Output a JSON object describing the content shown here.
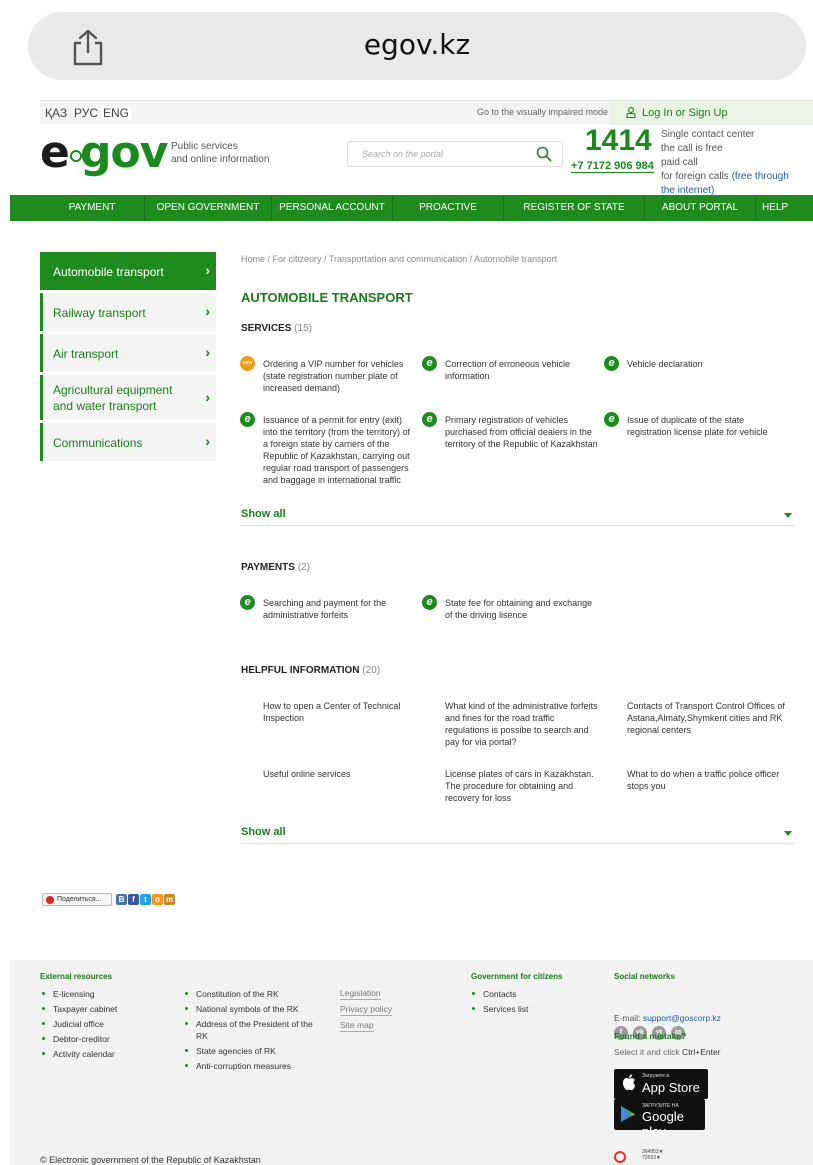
{
  "browser": {
    "url": "egov.kz"
  },
  "topline": {
    "languages": [
      "ҚАЗ",
      "РУС",
      "ENG"
    ],
    "impaired": "Go to the visually impaired mode",
    "login": "Log In or Sign Up"
  },
  "header": {
    "logo_e": "e",
    "logo_gov": "gov",
    "tagline_1": "Public services",
    "tagline_2": "and online information",
    "search_placeholder": "Search on the portal",
    "hotline": "1414",
    "phone": "+7 7172 906 984",
    "contact_1": "Single contact center",
    "contact_2": "the call is free",
    "contact_3": "paid call",
    "contact_4": "for foreign calls",
    "contact_link_1": "(free through",
    "contact_link_2": "the internet)"
  },
  "nav": [
    "PAYMENT",
    "OPEN GOVERNMENT",
    "PERSONAL ACCOUNT",
    "PROACTIVE SERVICES",
    "REGISTER OF STATE SERVICES",
    "ABOUT PORTAL",
    "HELP"
  ],
  "sidebar": [
    {
      "line1": "Automobile transport",
      "line2": ""
    },
    {
      "line1": "Railway transport",
      "line2": ""
    },
    {
      "line1": "Air transport",
      "line2": ""
    },
    {
      "line1": "Agricultural equipment",
      "line2": "and water transport"
    },
    {
      "line1": "Communications",
      "line2": ""
    }
  ],
  "main": {
    "breadcrumb": "Home / For citizenry / Transportation and communication / Automobile transport",
    "title": "AUTOMOBILE TRANSPORT",
    "services_label": "SERVICES",
    "services_count": "(15)",
    "services": [
      {
        "badge": "new",
        "lines": [
          "Ordering a VIP number for vehicles",
          "(state registration number plate of",
          "increased demand)"
        ]
      },
      {
        "badge": "e",
        "lines": [
          "Correction of erroneous vehicle",
          "information"
        ]
      },
      {
        "badge": "e",
        "lines": [
          "Vehicle declaration"
        ]
      },
      {
        "badge": "e",
        "lines": [
          "Issuance of a permit for entry (exit)",
          "into the territory (from the territory) of",
          "a foreign state by carriers of the",
          "Republic of Kazakhstan, carrying out",
          "regular road transport of passengers",
          "and baggage in international traffic"
        ]
      },
      {
        "badge": "e",
        "lines": [
          "Primary registration of vehicles",
          "purchased from official dealers in the",
          "territory of the Republic of Kazakhstan"
        ]
      },
      {
        "badge": "e",
        "lines": [
          "Issue of duplicate of the state",
          "registration license plate for vehicle"
        ]
      }
    ],
    "show_all": "Show all",
    "payments_label": "PAYMENTS",
    "payments_count": "(2)",
    "payments": [
      {
        "badge": "e",
        "lines": [
          "Searching and payment for the",
          "administrative forfeits"
        ]
      },
      {
        "badge": "e",
        "lines": [
          "State fee for obtaining and exchange",
          "of the driving lisence"
        ]
      }
    ],
    "helpful_label": "HELPFUL INFORMATION",
    "helpful_count": "(20)",
    "helpful": [
      {
        "lines": [
          "How to open a Center of Technical",
          "Inspection"
        ]
      },
      {
        "lines": [
          "What kind of the administrative forfeits",
          "and fines for the road traffic",
          "regulations is possibe to search and",
          "pay for via portal?"
        ]
      },
      {
        "lines": [
          "Contacts of Transport Control Offices of",
          "Astana,Almaty,Shymkent cities and RK",
          "regional centers"
        ]
      },
      {
        "lines": [
          "Useful online services"
        ]
      },
      {
        "lines": [
          "License plates of cars in Kazakhstan.",
          "The procedure for obtaining and",
          "recovery for loss"
        ]
      },
      {
        "lines": [
          "What to do when a traffic police officer",
          "stops you"
        ]
      }
    ]
  },
  "share": {
    "label": "Поделиться...",
    "icons": [
      "В",
      "f",
      "t",
      "o",
      "m"
    ]
  },
  "footer": {
    "external_title": "External resources",
    "external": [
      "E-licensing",
      "Taxpayer cabinet",
      "Judicial office",
      "Debtor-creditor",
      "Activity calendar"
    ],
    "col2": [
      "Constitution of the RK",
      "National symbols of the RK",
      "Address of the President of the",
      "RK",
      "State agencies of RK",
      "Anti-corruption measures"
    ],
    "links": [
      "Legislation",
      "Privacy policy",
      "Site map"
    ],
    "gov_title": "Government for citizens",
    "gov": [
      "Contacts",
      "Services list"
    ],
    "social_title": "Social networks",
    "social_icons": [
      "f",
      "vk",
      "yt",
      "ig"
    ],
    "email_label": "E-mail:",
    "email": "support@goscorp.kz",
    "mistake": "Found a mistake?",
    "select_text": "Select it and click",
    "select_keys": "Ctrl+Enter",
    "appstore_small": "Загрузите в",
    "appstore_big": "App Store",
    "gplay_small": "ЗАГРУЗИТЕ НА",
    "gplay_big": "Google play",
    "copyright": "© Electronic government of the Republic of Kazakhstan",
    "counter_1": "264953▼",
    "counter_2": "72653▼"
  }
}
